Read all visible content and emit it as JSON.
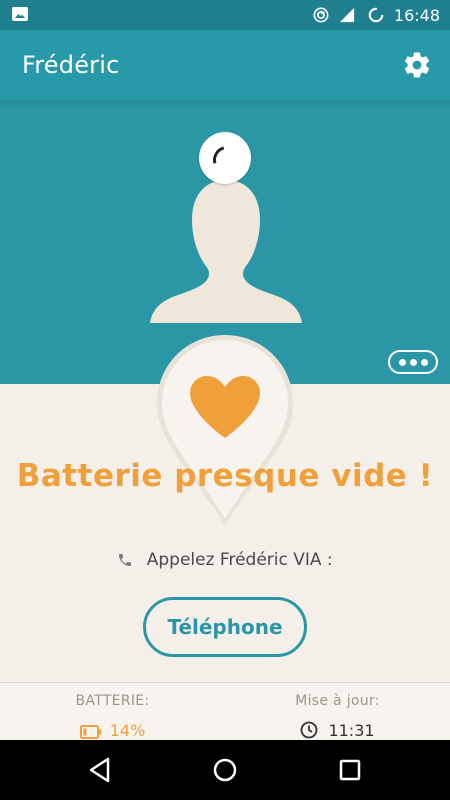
{
  "status_bar": {
    "time": "16:48",
    "icons": [
      "image-icon",
      "sync-icon",
      "signal-icon",
      "loading-icon"
    ]
  },
  "app_bar": {
    "title": "Frédéric",
    "settings_icon": "gear-icon"
  },
  "profile": {
    "avatar_icon": "person-silhouette",
    "spinner": "loading-spinner",
    "more_icon": "more-dots-icon"
  },
  "alert": {
    "heart_icon": "heart-icon",
    "message": "Batterie presque vide !"
  },
  "call": {
    "prompt": "Appelez Frédéric VIA :",
    "phone_icon": "phone-icon",
    "button_label": "Téléphone"
  },
  "info": {
    "battery_label": "BATTERIE:",
    "battery_value": "14%",
    "update_label": "Mise à jour:",
    "update_value": "11:31"
  },
  "colors": {
    "teal": "#2b97a6",
    "status_teal": "#1f7f8f",
    "orange": "#f0a03a",
    "cream": "#f4efe8"
  }
}
